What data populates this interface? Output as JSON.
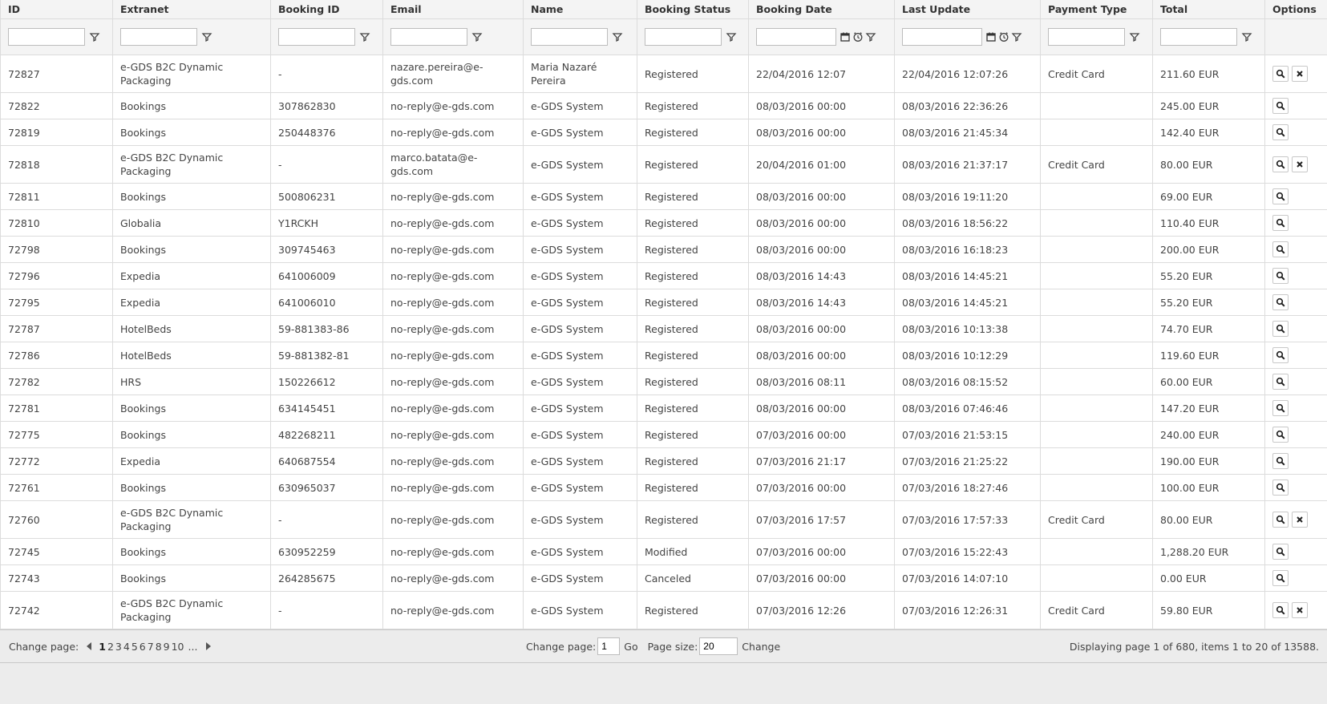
{
  "columns": [
    "ID",
    "Extranet",
    "Booking ID",
    "Email",
    "Name",
    "Booking Status",
    "Booking Date",
    "Last Update",
    "Payment Type",
    "Total",
    "Options"
  ],
  "rows": [
    {
      "id": "72827",
      "extranet": "e-GDS B2C Dynamic Packaging",
      "booking_id": "-",
      "email": "nazare.pereira@e-gds.com",
      "name": "Maria Nazaré Pereira",
      "status": "Registered",
      "booking_date": "22/04/2016 12:07",
      "last_update": "22/04/2016 12:07:26",
      "payment": "Credit Card",
      "total": "211.60 EUR",
      "cancel": true
    },
    {
      "id": "72822",
      "extranet": "Bookings",
      "booking_id": "307862830",
      "email": "no-reply@e-gds.com",
      "name": "e-GDS System",
      "status": "Registered",
      "booking_date": "08/03/2016 00:00",
      "last_update": "08/03/2016 22:36:26",
      "payment": "",
      "total": "245.00 EUR",
      "cancel": false
    },
    {
      "id": "72819",
      "extranet": "Bookings",
      "booking_id": "250448376",
      "email": "no-reply@e-gds.com",
      "name": "e-GDS System",
      "status": "Registered",
      "booking_date": "08/03/2016 00:00",
      "last_update": "08/03/2016 21:45:34",
      "payment": "",
      "total": "142.40 EUR",
      "cancel": false
    },
    {
      "id": "72818",
      "extranet": "e-GDS B2C Dynamic Packaging",
      "booking_id": "-",
      "email": "marco.batata@e-gds.com",
      "name": "e-GDS System",
      "status": "Registered",
      "booking_date": "20/04/2016 01:00",
      "last_update": "08/03/2016 21:37:17",
      "payment": "Credit Card",
      "total": "80.00 EUR",
      "cancel": true
    },
    {
      "id": "72811",
      "extranet": "Bookings",
      "booking_id": "500806231",
      "email": "no-reply@e-gds.com",
      "name": "e-GDS System",
      "status": "Registered",
      "booking_date": "08/03/2016 00:00",
      "last_update": "08/03/2016 19:11:20",
      "payment": "",
      "total": "69.00 EUR",
      "cancel": false
    },
    {
      "id": "72810",
      "extranet": "Globalia",
      "booking_id": "Y1RCKH",
      "email": "no-reply@e-gds.com",
      "name": "e-GDS System",
      "status": "Registered",
      "booking_date": "08/03/2016 00:00",
      "last_update": "08/03/2016 18:56:22",
      "payment": "",
      "total": "110.40 EUR",
      "cancel": false
    },
    {
      "id": "72798",
      "extranet": "Bookings",
      "booking_id": "309745463",
      "email": "no-reply@e-gds.com",
      "name": "e-GDS System",
      "status": "Registered",
      "booking_date": "08/03/2016 00:00",
      "last_update": "08/03/2016 16:18:23",
      "payment": "",
      "total": "200.00 EUR",
      "cancel": false
    },
    {
      "id": "72796",
      "extranet": "Expedia",
      "booking_id": "641006009",
      "email": "no-reply@e-gds.com",
      "name": "e-GDS System",
      "status": "Registered",
      "booking_date": "08/03/2016 14:43",
      "last_update": "08/03/2016 14:45:21",
      "payment": "",
      "total": "55.20 EUR",
      "cancel": false
    },
    {
      "id": "72795",
      "extranet": "Expedia",
      "booking_id": "641006010",
      "email": "no-reply@e-gds.com",
      "name": "e-GDS System",
      "status": "Registered",
      "booking_date": "08/03/2016 14:43",
      "last_update": "08/03/2016 14:45:21",
      "payment": "",
      "total": "55.20 EUR",
      "cancel": false
    },
    {
      "id": "72787",
      "extranet": "HotelBeds",
      "booking_id": "59-881383-86",
      "email": "no-reply@e-gds.com",
      "name": "e-GDS System",
      "status": "Registered",
      "booking_date": "08/03/2016 00:00",
      "last_update": "08/03/2016 10:13:38",
      "payment": "",
      "total": "74.70 EUR",
      "cancel": false
    },
    {
      "id": "72786",
      "extranet": "HotelBeds",
      "booking_id": "59-881382-81",
      "email": "no-reply@e-gds.com",
      "name": "e-GDS System",
      "status": "Registered",
      "booking_date": "08/03/2016 00:00",
      "last_update": "08/03/2016 10:12:29",
      "payment": "",
      "total": "119.60 EUR",
      "cancel": false
    },
    {
      "id": "72782",
      "extranet": "HRS",
      "booking_id": "150226612",
      "email": "no-reply@e-gds.com",
      "name": "e-GDS System",
      "status": "Registered",
      "booking_date": "08/03/2016 08:11",
      "last_update": "08/03/2016 08:15:52",
      "payment": "",
      "total": "60.00 EUR",
      "cancel": false
    },
    {
      "id": "72781",
      "extranet": "Bookings",
      "booking_id": "634145451",
      "email": "no-reply@e-gds.com",
      "name": "e-GDS System",
      "status": "Registered",
      "booking_date": "08/03/2016 00:00",
      "last_update": "08/03/2016 07:46:46",
      "payment": "",
      "total": "147.20 EUR",
      "cancel": false
    },
    {
      "id": "72775",
      "extranet": "Bookings",
      "booking_id": "482268211",
      "email": "no-reply@e-gds.com",
      "name": "e-GDS System",
      "status": "Registered",
      "booking_date": "07/03/2016 00:00",
      "last_update": "07/03/2016 21:53:15",
      "payment": "",
      "total": "240.00 EUR",
      "cancel": false
    },
    {
      "id": "72772",
      "extranet": "Expedia",
      "booking_id": "640687554",
      "email": "no-reply@e-gds.com",
      "name": "e-GDS System",
      "status": "Registered",
      "booking_date": "07/03/2016 21:17",
      "last_update": "07/03/2016 21:25:22",
      "payment": "",
      "total": "190.00 EUR",
      "cancel": false
    },
    {
      "id": "72761",
      "extranet": "Bookings",
      "booking_id": "630965037",
      "email": "no-reply@e-gds.com",
      "name": "e-GDS System",
      "status": "Registered",
      "booking_date": "07/03/2016 00:00",
      "last_update": "07/03/2016 18:27:46",
      "payment": "",
      "total": "100.00 EUR",
      "cancel": false
    },
    {
      "id": "72760",
      "extranet": "e-GDS B2C Dynamic Packaging",
      "booking_id": "-",
      "email": "no-reply@e-gds.com",
      "name": "e-GDS System",
      "status": "Registered",
      "booking_date": "07/03/2016 17:57",
      "last_update": "07/03/2016 17:57:33",
      "payment": "Credit Card",
      "total": "80.00 EUR",
      "cancel": true
    },
    {
      "id": "72745",
      "extranet": "Bookings",
      "booking_id": "630952259",
      "email": "no-reply@e-gds.com",
      "name": "e-GDS System",
      "status": "Modified",
      "booking_date": "07/03/2016 00:00",
      "last_update": "07/03/2016 15:22:43",
      "payment": "",
      "total": "1,288.20 EUR",
      "cancel": false
    },
    {
      "id": "72743",
      "extranet": "Bookings",
      "booking_id": "264285675",
      "email": "no-reply@e-gds.com",
      "name": "e-GDS System",
      "status": "Canceled",
      "booking_date": "07/03/2016 00:00",
      "last_update": "07/03/2016 14:07:10",
      "payment": "",
      "total": "0.00 EUR",
      "cancel": false
    },
    {
      "id": "72742",
      "extranet": "e-GDS B2C Dynamic Packaging",
      "booking_id": "-",
      "email": "no-reply@e-gds.com",
      "name": "e-GDS System",
      "status": "Registered",
      "booking_date": "07/03/2016 12:26",
      "last_update": "07/03/2016 12:26:31",
      "payment": "Credit Card",
      "total": "59.80 EUR",
      "cancel": true
    }
  ],
  "pager": {
    "change_page_label": "Change page:",
    "current_page": "1",
    "pages": [
      "2",
      "3",
      "4",
      "5",
      "6",
      "7",
      "8",
      "9",
      "10"
    ],
    "ellipsis": "...",
    "goto_label": "Change page:",
    "goto_value": "1",
    "go_label": "Go",
    "page_size_label": "Page size:",
    "page_size_value": "20",
    "change_label": "Change",
    "summary": "Displaying page 1 of 680, items 1 to 20 of 13588."
  }
}
